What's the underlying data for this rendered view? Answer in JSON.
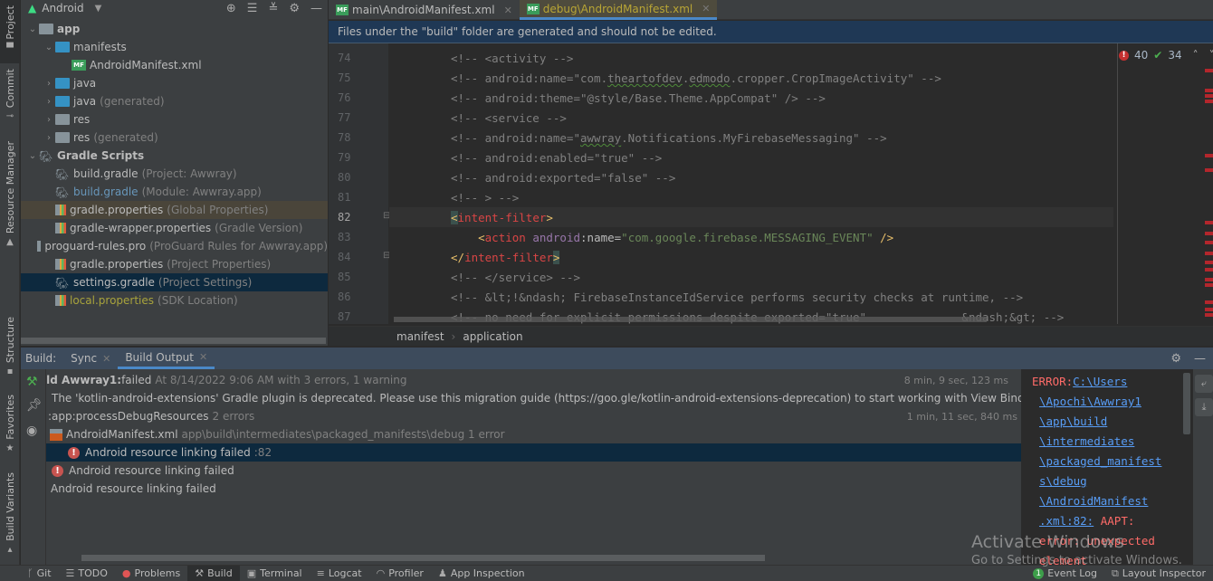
{
  "left_strip": {
    "tabs": [
      {
        "label": "Project",
        "icon": "folder-icon"
      },
      {
        "label": "Commit",
        "icon": "commit-icon"
      },
      {
        "label": "Resource Manager",
        "icon": "shapes-icon"
      },
      {
        "label": "Structure",
        "icon": "structure-icon"
      },
      {
        "label": "Favorites",
        "icon": "star-icon"
      },
      {
        "label": "Build Variants",
        "icon": "android-icon"
      }
    ]
  },
  "project": {
    "view_selector": "Android",
    "tree": [
      {
        "label": "app",
        "sub": "",
        "level": 0,
        "expanded": true,
        "icon": "module-folder-icon"
      },
      {
        "label": "manifests",
        "sub": "",
        "level": 1,
        "expanded": true,
        "icon": "folder-icon"
      },
      {
        "label": "AndroidManifest.xml",
        "sub": "",
        "level": 2,
        "icon": "manifest-file-icon"
      },
      {
        "label": "java",
        "sub": "",
        "level": 1,
        "expanded": false,
        "icon": "folder-icon"
      },
      {
        "label": "java",
        "sub": "(generated)",
        "level": 1,
        "expanded": false,
        "icon": "generated-folder-icon"
      },
      {
        "label": "res",
        "sub": "",
        "level": 1,
        "expanded": false,
        "icon": "res-folder-icon"
      },
      {
        "label": "res",
        "sub": "(generated)",
        "level": 1,
        "expanded": false,
        "icon": "res-folder-icon"
      },
      {
        "label": "Gradle Scripts",
        "sub": "",
        "level": 0,
        "expanded": true,
        "icon": "gradle-icon"
      },
      {
        "label": "build.gradle",
        "sub": "(Project: Awwray)",
        "level": 1,
        "icon": "gradle-icon"
      },
      {
        "label": "build.gradle",
        "sub": "(Module: Awwray.app)",
        "level": 1,
        "icon": "gradle-icon",
        "color": "#6897bb"
      },
      {
        "label": "gradle.properties",
        "sub": "(Global Properties)",
        "level": 1,
        "icon": "properties-icon"
      },
      {
        "label": "gradle-wrapper.properties",
        "sub": "(Gradle Version)",
        "level": 1,
        "icon": "properties-icon"
      },
      {
        "label": "proguard-rules.pro",
        "sub": "(ProGuard Rules for Awwray.app)",
        "level": 1,
        "icon": "text-file-icon"
      },
      {
        "label": "gradle.properties",
        "sub": "(Project Properties)",
        "level": 1,
        "icon": "properties-icon"
      },
      {
        "label": "settings.gradle",
        "sub": "(Project Settings)",
        "level": 1,
        "icon": "gradle-icon"
      },
      {
        "label": "local.properties",
        "sub": "(SDK Location)",
        "level": 1,
        "icon": "properties-icon",
        "color": "#a8a33c"
      }
    ]
  },
  "editor": {
    "tabs": [
      {
        "label": "main\\AndroidManifest.xml",
        "active": false
      },
      {
        "label": "debug\\AndroidManifest.xml",
        "active": true
      }
    ],
    "banner": "Files under the \"build\" folder are generated and should not be edited.",
    "inspection": {
      "errors": "40",
      "warnings": "34"
    },
    "lines": [
      {
        "no": "74",
        "text": "<!-- <activity -->"
      },
      {
        "no": "75",
        "pre": "<!-- android:name=\"com.",
        "sq1": "theartofdev",
        "mid": ".",
        "sq2": "edmodo",
        "post": ".cropper.CropImageActivity\" -->"
      },
      {
        "no": "76",
        "text": "<!-- android:theme=\"@style/Base.Theme.AppCompat\" /> -->"
      },
      {
        "no": "77",
        "text": "<!-- <service -->"
      },
      {
        "no": "78",
        "pre": "<!-- android:name=\"",
        "sq1": "awwray",
        "post": ".Notifications.MyFirebaseMessaging\" -->"
      },
      {
        "no": "79",
        "text": "<!-- android:enabled=\"true\" -->"
      },
      {
        "no": "80",
        "text": "<!-- android:exported=\"false\" -->"
      },
      {
        "no": "81",
        "text": "<!-- > -->"
      },
      {
        "no": "82",
        "open_br": "<",
        "tag": "intent-filter",
        "close_br": ">"
      },
      {
        "no": "83",
        "open_br": "<",
        "tag": "action",
        "ns": "android",
        "attr": ":name=",
        "value": "\"com.google.firebase.MESSAGING_EVENT\"",
        "end": " />"
      },
      {
        "no": "84",
        "open_br": "</",
        "tag": "intent-filter",
        "close_br": ">"
      },
      {
        "no": "85",
        "text": "<!-- </service> -->"
      },
      {
        "no": "86",
        "text": "<!-- &lt;!&ndash; FirebaseInstanceIdService performs security checks at runtime, -->"
      },
      {
        "no": "87",
        "text": "<!-- no need for explicit permissions despite exported=\"true\"              &ndash;&gt; -->"
      }
    ],
    "breadcrumbs": [
      "manifest",
      "application"
    ]
  },
  "build": {
    "label": "Build:",
    "tabs": [
      {
        "label": "Sync",
        "active": false
      },
      {
        "label": "Build Output",
        "active": true
      }
    ],
    "rows": [
      {
        "bold": "ild Awwray1:",
        "text": " failed",
        "dim": "At 8/14/2022 9:06 AM with 3 errors, 1 warning",
        "duration": "8 min, 9 sec, 123 ms"
      },
      {
        "text": "The 'kotlin-android-extensions' Gradle plugin is deprecated. Please use this migration guide (https://goo.gle/kotlin-android-extensions-deprecation) to start working with View Binding (https://developer.android.com"
      },
      {
        "text": ":app:processDebugResources",
        "dim": " 2 errors",
        "duration": "1 min, 11 sec, 840 ms"
      },
      {
        "text": "AndroidManifest.xml",
        "dim": "app\\build\\intermediates\\packaged_manifests\\debug 1 error"
      },
      {
        "text": "Android resource linking failed",
        "dim": ":82"
      },
      {
        "text": "Android resource linking failed"
      },
      {
        "text": "Android resource linking failed"
      }
    ],
    "console": [
      {
        "err": "ERROR:",
        "link": "C:\\Users"
      },
      {
        "link": "\\Apochi\\Awwray1"
      },
      {
        "link": "\\app\\build"
      },
      {
        "link": "\\intermediates"
      },
      {
        "link": "\\packaged_manifest"
      },
      {
        "link": "s\\debug"
      },
      {
        "link": "\\AndroidManifest"
      },
      {
        "link": ".xml:82:",
        "err": " AAPT:"
      },
      {
        "err": "error: unexpected"
      },
      {
        "err": "element"
      }
    ]
  },
  "status_bar": {
    "items": [
      {
        "label": "Git",
        "icon": "git-icon"
      },
      {
        "label": "TODO",
        "icon": "list-icon"
      },
      {
        "label": "Problems",
        "icon": "error-icon"
      },
      {
        "label": "Build",
        "icon": "hammer-icon",
        "active": true
      },
      {
        "label": "Terminal",
        "icon": "terminal-icon"
      },
      {
        "label": "Logcat",
        "icon": "logcat-icon"
      },
      {
        "label": "Profiler",
        "icon": "gauge-icon"
      },
      {
        "label": "App Inspection",
        "icon": "inspect-icon"
      }
    ],
    "right": [
      {
        "label": "Event Log",
        "badge": "1"
      },
      {
        "label": "Layout Inspector"
      }
    ]
  },
  "watermark": {
    "title": "Activate Windows",
    "subtitle": "Go to Settings to activate Windows."
  }
}
